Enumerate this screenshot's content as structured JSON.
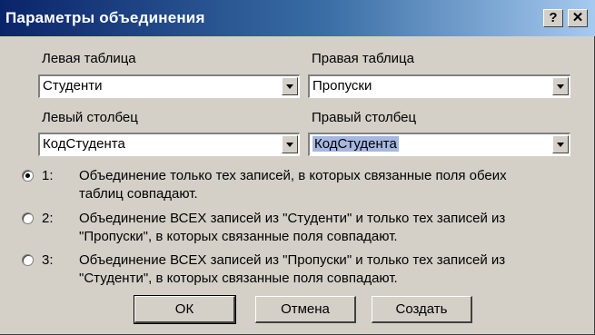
{
  "window": {
    "title": "Параметры объединения",
    "help_label": "?",
    "close_label": "✕"
  },
  "left_table": {
    "label": "Левая таблица",
    "value": "Студенти"
  },
  "right_table": {
    "label": "Правая таблица",
    "value": "Пропуски"
  },
  "left_column": {
    "label": "Левый столбец",
    "value": "КодСтудента"
  },
  "right_column": {
    "label": "Правый столбец",
    "value": "КодСтудента"
  },
  "join_options": [
    {
      "number": "1:",
      "line1": "Объединение только тех записей, в которых связанные поля обеих",
      "line2": "таблиц совпадают.",
      "checked": true
    },
    {
      "number": "2:",
      "line1": "Объединение ВСЕХ записей из \"Студенти\" и только тех записей из",
      "line2": "\"Пропуски\", в которых связанные поля совпадают.",
      "checked": false
    },
    {
      "number": "3:",
      "line1": "Объединение ВСЕХ записей из \"Пропуски\" и только тех записей из",
      "line2": "\"Студенти\", в которых связанные поля совпадают.",
      "checked": false
    }
  ],
  "buttons": {
    "ok": "ОК",
    "cancel": "Отмена",
    "create": "Создать"
  },
  "colors": {
    "titlebar_start": "#0a246a",
    "titlebar_end": "#a6caf0",
    "face": "#d4d0c8"
  }
}
